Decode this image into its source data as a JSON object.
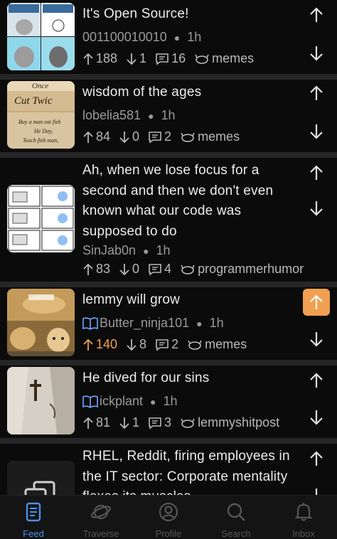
{
  "posts": [
    {
      "title": "It's Open Source!",
      "author": "001100010010",
      "time": "1h",
      "upvotes": "188",
      "downvotes": "1",
      "comments": "16",
      "community": "memes",
      "upvoted": false,
      "moderator": false
    },
    {
      "title": "wisdom of the ages",
      "author": "lobelia581",
      "time": "1h",
      "upvotes": "84",
      "downvotes": "0",
      "comments": "2",
      "community": "memes",
      "upvoted": false,
      "moderator": false
    },
    {
      "title": "Ah, when we lose focus for a second and then we don't even known what our code was supposed to do",
      "author": "SinJab0n",
      "time": "1h",
      "upvotes": "83",
      "downvotes": "0",
      "comments": "4",
      "community": "programmerhumor",
      "upvoted": false,
      "moderator": false
    },
    {
      "title": "lemmy will grow",
      "author": "Butter_ninja101",
      "time": "1h",
      "upvotes": "140",
      "downvotes": "8",
      "comments": "2",
      "community": "memes",
      "upvoted": true,
      "moderator": true
    },
    {
      "title": "He dived for our sins",
      "author": "ickplant",
      "time": "1h",
      "upvotes": "81",
      "downvotes": "1",
      "comments": "3",
      "community": "lemmyshitpost",
      "upvoted": false,
      "moderator": true
    },
    {
      "title": "RHEL, Reddit, firing employees in the IT sector: Corporate mentality flexes its muscles"
    }
  ],
  "thumb_text": {
    "wisdom_a": "Once",
    "wisdom_b": "Cut Twic",
    "wisdom_c": "Buy a man eat fish",
    "wisdom_d": "He Day,",
    "wisdom_e": "Teach fish man,"
  },
  "tabs": [
    {
      "label": "Feed",
      "icon": "feed-icon",
      "active": true
    },
    {
      "label": "Traverse",
      "icon": "planet-icon",
      "active": false
    },
    {
      "label": "Profile",
      "icon": "profile-icon",
      "active": false
    },
    {
      "label": "Search",
      "icon": "search-icon",
      "active": false
    },
    {
      "label": "Inbox",
      "icon": "bell-icon",
      "active": false
    }
  ],
  "colors": {
    "accent": "#4a8fe7",
    "upvote_active": "#f0a050",
    "background": "#000000",
    "card": "#0b0b0b"
  }
}
